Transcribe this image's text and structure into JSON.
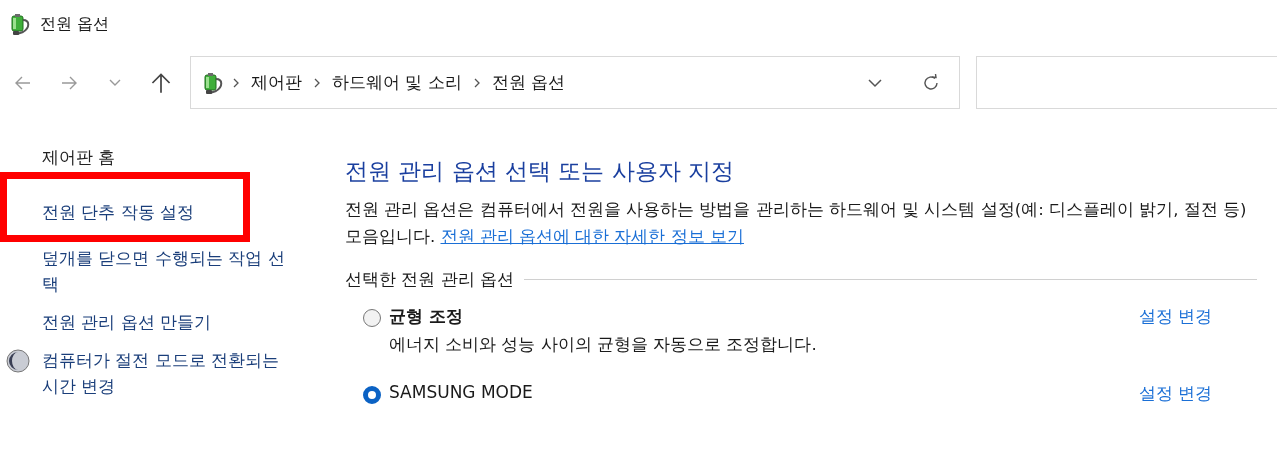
{
  "window": {
    "title": "전원 옵션"
  },
  "nav": {
    "breadcrumbs": [
      "제어판",
      "하드웨어 및 소리",
      "전원 옵션"
    ]
  },
  "sidebar": {
    "items": [
      {
        "label": "제어판 홈",
        "kind": "plain",
        "highlighted": false
      },
      {
        "label": "전원 단추 작동 설정",
        "kind": "link",
        "highlighted": true
      },
      {
        "label": "덮개를 닫으면 수행되는 작업 선택",
        "kind": "link",
        "highlighted": false
      },
      {
        "label": "전원 관리 옵션 만들기",
        "kind": "link",
        "highlighted": false
      },
      {
        "label": "컴퓨터가 절전 모드로 전환되는 시간 변경",
        "kind": "icon-link",
        "highlighted": false
      }
    ]
  },
  "main": {
    "heading": "전원 관리 옵션 선택 또는 사용자 지정",
    "description": "전원 관리 옵션은 컴퓨터에서 전원을 사용하는 방법을 관리하는 하드웨어 및 시스템 설정(예: 디스플레이 밝기, 절전 등) 모음입니다.",
    "description_link": "전원 관리 옵션에 대한 자세한 정보 보기",
    "group_label": "선택한 전원 관리 옵션",
    "plans": [
      {
        "name": "균형 조정",
        "bold": true,
        "selected": false,
        "description": "에너지 소비와 성능 사이의 균형을 자동으로 조정합니다.",
        "action": "설정 변경"
      },
      {
        "name": "SAMSUNG MODE",
        "bold": false,
        "selected": true,
        "action": "설정 변경"
      }
    ]
  }
}
